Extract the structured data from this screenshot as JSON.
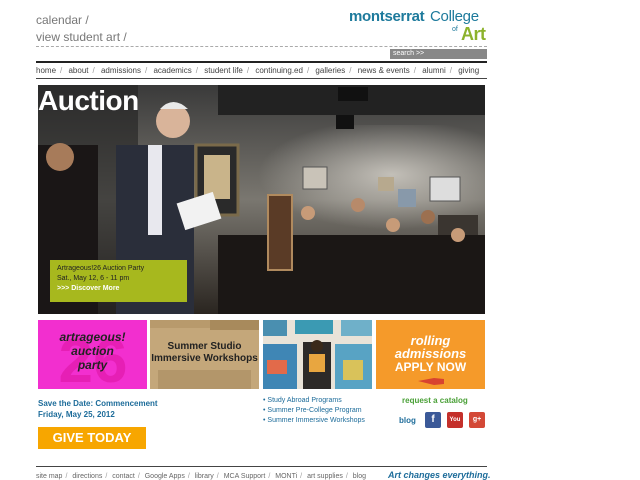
{
  "top_links": [
    "calendar /",
    "view student art /"
  ],
  "logo": {
    "part1": "montserrat",
    "part2": "College",
    "of": "of",
    "art": "Art"
  },
  "search": {
    "label": "search >>"
  },
  "nav": [
    "home",
    "about",
    "admissions",
    "academics",
    "student life",
    "continuing.ed",
    "galleries",
    "news & events",
    "alumni",
    "giving"
  ],
  "hero": {
    "title": "Auction",
    "promo_line1": "Artrageous!26 Auction Party",
    "promo_line2": "Sat., May 12, 6 - 11 pm",
    "promo_more": ">>> Discover More"
  },
  "tiles": {
    "auction": [
      "artrageous!",
      "auction",
      "party"
    ],
    "summer": [
      "Summer Studio",
      "Immersive Workshops"
    ],
    "rolling": [
      "rolling",
      "admissions"
    ],
    "apply": "APPLY NOW"
  },
  "commencement": {
    "line1": "Save the Date: Commencement",
    "line2": "Friday, May 25, 2012"
  },
  "give_today": "GIVE TODAY",
  "program_links": [
    "• Study Abroad Programs",
    "• Summer Pre-College Program",
    "• Summer Immersive Workshops"
  ],
  "request_catalog": "request a catalog",
  "blog": "blog",
  "social": {
    "fb": "f",
    "yt": "You",
    "gp": "g+"
  },
  "footer": [
    "site map",
    "directions",
    "contact",
    "Google Apps",
    "library",
    "MCA Support",
    "MONTi",
    "art supplies",
    "blog"
  ],
  "tagline": "Art changes everything."
}
